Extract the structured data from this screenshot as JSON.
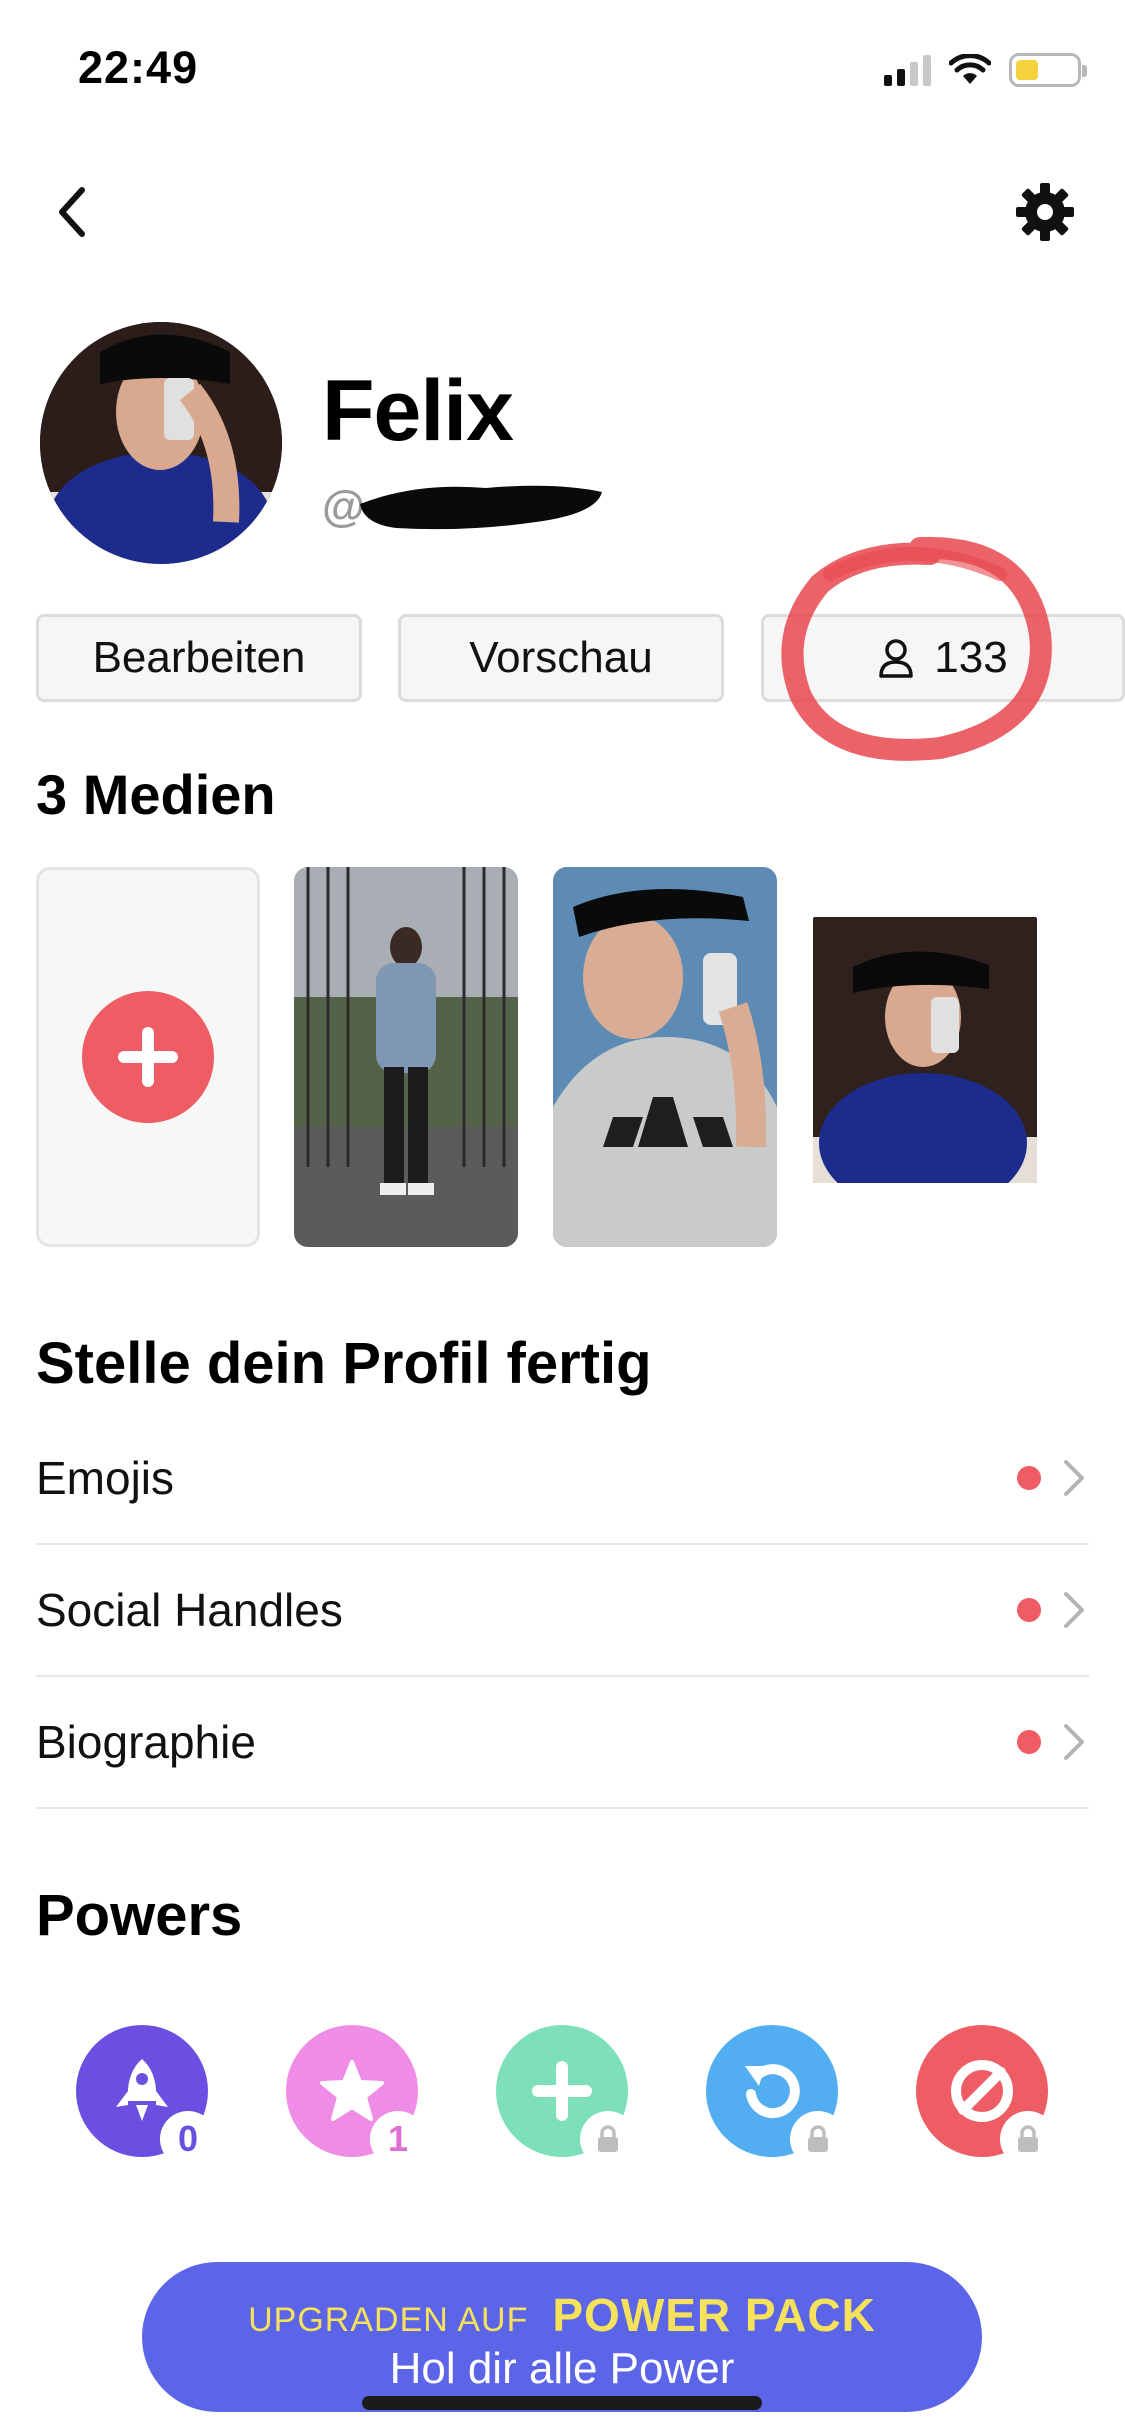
{
  "status_bar": {
    "time": "22:49",
    "signal_icon": "cellular-signal-icon",
    "wifi_icon": "wifi-icon",
    "battery_icon": "battery-icon",
    "battery_level": 0.25
  },
  "nav": {
    "back_icon": "chevron-left-icon",
    "settings_icon": "gear-icon"
  },
  "profile": {
    "name": "Felix",
    "username_prefix": "@"
  },
  "buttons": {
    "edit": "Bearbeiten",
    "preview": "Vorschau",
    "friends_count": "133",
    "friends_icon": "person-icon"
  },
  "media": {
    "title": "3 Medien",
    "add_icon": "plus-icon"
  },
  "complete_profile": {
    "title": "Stelle dein Profil fertig",
    "items": [
      {
        "label": "Emojis"
      },
      {
        "label": "Social Handles"
      },
      {
        "label": "Biographie"
      }
    ]
  },
  "powers": {
    "title": "Powers",
    "items": [
      {
        "icon": "rocket-icon",
        "color": "#6a4fe0",
        "badge": "0",
        "badge_color": "#6a4fe0"
      },
      {
        "icon": "star-icon",
        "color": "#ef8ce6",
        "badge": "1",
        "badge_color": "#e06ed4"
      },
      {
        "icon": "plus-icon",
        "color": "#7ee0b8",
        "badge_icon": "lock-icon"
      },
      {
        "icon": "rewind-icon",
        "color": "#52aef0",
        "badge_icon": "lock-icon"
      },
      {
        "icon": "block-icon",
        "color": "#ee5c64",
        "badge_icon": "lock-icon"
      }
    ]
  },
  "upgrade": {
    "prefix": "UPGRADEN AUF",
    "brand": "POWER PACK",
    "subtitle": "Hol dir alle Power"
  },
  "colors": {
    "accent_red": "#ee5c64",
    "upgrade_blue": "#5c64e8",
    "upgrade_yellow": "#f4e15c"
  }
}
